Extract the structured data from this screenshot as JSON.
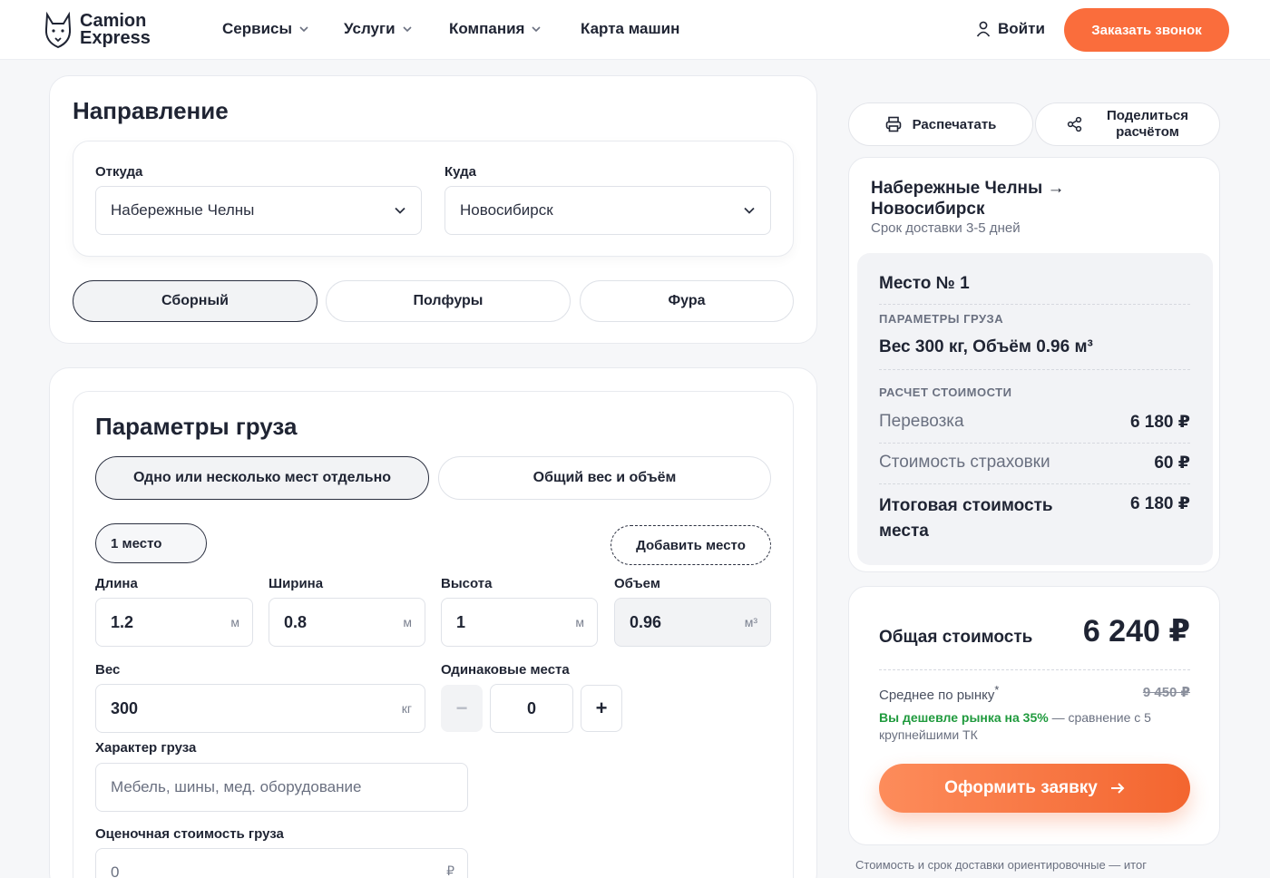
{
  "header": {
    "logo_line1": "Camion",
    "logo_line2": "Express",
    "nav": [
      {
        "label": "Сервисы",
        "has_dropdown": true
      },
      {
        "label": "Услуги",
        "has_dropdown": true
      },
      {
        "label": "Компания",
        "has_dropdown": true
      },
      {
        "label": "Карта машин",
        "has_dropdown": false
      }
    ],
    "login_label": "Войти",
    "cta_label": "Заказать звонок"
  },
  "direction": {
    "title": "Направление",
    "from_label": "Откуда",
    "from_value": "Набережные Челны",
    "to_label": "Куда",
    "to_value": "Новосибирск",
    "transport_types": [
      {
        "label": "Сборный",
        "active": true
      },
      {
        "label": "Полфуры",
        "active": false
      },
      {
        "label": "Фура",
        "active": false
      }
    ]
  },
  "cargo": {
    "title": "Параметры груза",
    "modes": [
      {
        "label": "Одно или несколько мест отдельно",
        "active": true
      },
      {
        "label": "Общий вес и объём",
        "active": false
      }
    ],
    "place_tab": "1 место",
    "add_place": "Добавить место",
    "length": {
      "label": "Длина",
      "value": "1.2",
      "unit": "м"
    },
    "width": {
      "label": "Ширина",
      "value": "0.8",
      "unit": "м"
    },
    "height": {
      "label": "Высота",
      "value": "1",
      "unit": "м"
    },
    "volume": {
      "label": "Объем",
      "value": "0.96",
      "unit": "м³"
    },
    "weight": {
      "label": "Вес",
      "value": "300",
      "unit": "кг"
    },
    "same_places": {
      "label": "Одинаковые места",
      "value": "0",
      "minus": "−",
      "plus": "+"
    },
    "nature": {
      "label": "Характер груза",
      "placeholder": "Мебель, шины, мед. оборудование"
    },
    "declared_value": {
      "label": "Оценочная стоимость груза",
      "value": "0",
      "unit": "₽"
    }
  },
  "actions": {
    "print": "Распечатать",
    "share_line1": "Поделиться",
    "share_line2": "расчётом"
  },
  "summary": {
    "route_line1": "Набережные Челны →",
    "route_line2": "Новосибирск",
    "delivery_time": "Срок доставки 3-5 дней",
    "place_title": "Место № 1",
    "params_caption": "ПАРАМЕТРЫ ГРУЗА",
    "params_value": "Вес 300 кг, Объём 0.96 м³",
    "calc_caption": "РАСЧЕТ СТОИМОСТИ",
    "transport_label": "Перевозка",
    "transport_value": "6 180 ₽",
    "insurance_label": "Стоимость страховки",
    "insurance_value": "60 ₽",
    "place_total_line1": "Итоговая стоимость",
    "place_total_line2": "места",
    "place_total_value": "6 180 ₽"
  },
  "total": {
    "label": "Общая стоимость",
    "value": "6 240 ₽",
    "market_label": "Среднее по рынку",
    "market_mark": "*",
    "market_value": "9 450 ₽",
    "cheaper_text": "Вы дешевле рынка на 35%",
    "compare_text": "— сравнение с 5 крупнейшими ТК",
    "submit_label": "Оформить заявку",
    "note": "Стоимость и срок доставки ориентировочные — итог"
  },
  "colors": {
    "accent": "#fa6d3c",
    "green": "#1f9a3d",
    "text": "#1f2433"
  }
}
